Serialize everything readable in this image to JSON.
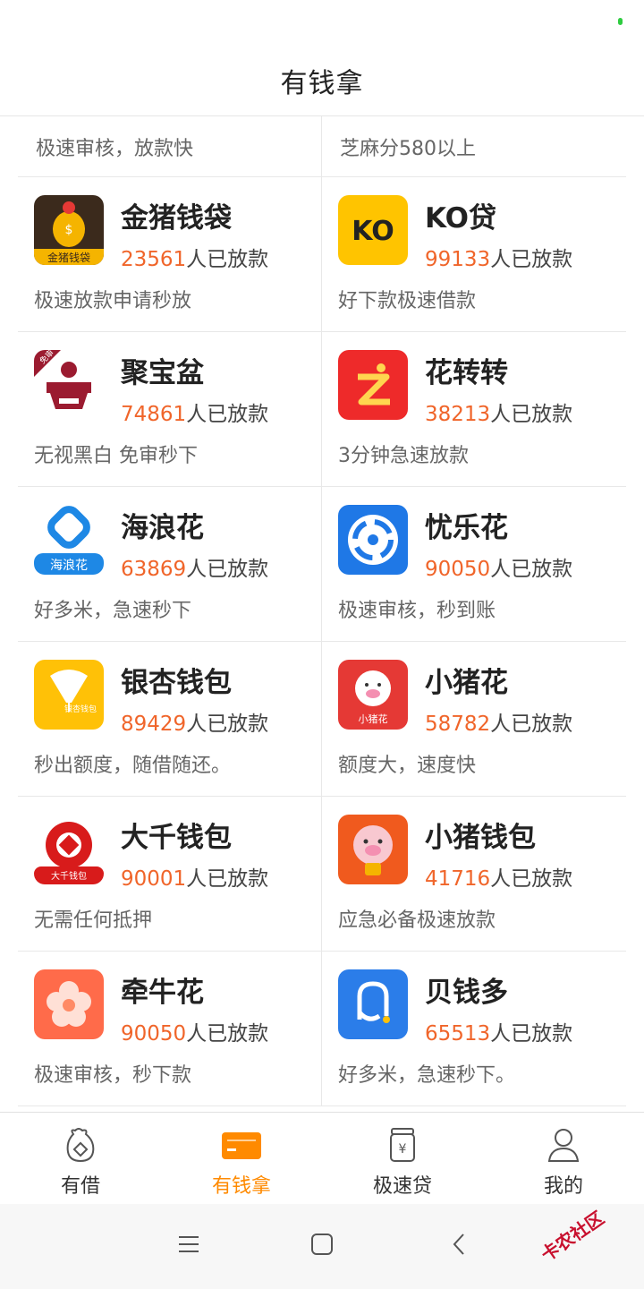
{
  "title": "有钱拿",
  "partial_row": {
    "left_desc": "极速审核，放款快",
    "right_desc": "芝麻分580以上"
  },
  "count_suffix": "人已放款",
  "apps": [
    {
      "name": "金猪钱袋",
      "count": "23561",
      "desc": "极速放款申请秒放",
      "icon": "golden-pig-bag-icon",
      "icon_text": "金猪钱袋",
      "color": "#3b2a1c"
    },
    {
      "name": "KO贷",
      "count": "99133",
      "desc": "好下款极速借款",
      "icon": "ko-loan-icon",
      "icon_text": "KO",
      "color": "#ffc400"
    },
    {
      "name": "聚宝盆",
      "count": "74861",
      "desc": "无视黑白 免审秒下",
      "icon": "treasure-bowl-icon",
      "icon_text": "免审",
      "color": "#9b1b30"
    },
    {
      "name": "花转转",
      "count": "38213",
      "desc": "3分钟急速放款",
      "icon": "hua-zhuanzhuan-icon",
      "icon_text": "",
      "color": "#ee2a2a"
    },
    {
      "name": "海浪花",
      "count": "63869",
      "desc": "好多米，急速秒下",
      "icon": "hailang-flower-icon",
      "icon_text": "海浪花",
      "color": "#1e88e5"
    },
    {
      "name": "忧乐花",
      "count": "90050",
      "desc": "极速审核，秒到账",
      "icon": "youle-flower-icon",
      "icon_text": "",
      "color": "#1f78e6"
    },
    {
      "name": "银杏钱包",
      "count": "89429",
      "desc": "秒出额度，随借随还。",
      "icon": "ginkgo-wallet-icon",
      "icon_text": "银杏钱包",
      "color": "#ffc107"
    },
    {
      "name": "小猪花",
      "count": "58782",
      "desc": "额度大，速度快",
      "icon": "little-pig-flower-icon",
      "icon_text": "小猪花",
      "color": "#e53935"
    },
    {
      "name": "大千钱包",
      "count": "90001",
      "desc": "无需任何抵押",
      "icon": "daqian-wallet-icon",
      "icon_text": "大千钱包",
      "color": "#d81b1b"
    },
    {
      "name": "小猪钱包",
      "count": "41716",
      "desc": "应急必备极速放款",
      "icon": "pig-wallet-icon",
      "icon_text": "",
      "color": "#f05a1e"
    },
    {
      "name": "牵牛花",
      "count": "90050",
      "desc": "极速审核，秒下款",
      "icon": "morning-glory-icon",
      "icon_text": "",
      "color": "#ff6b4a"
    },
    {
      "name": "贝钱多",
      "count": "65513",
      "desc": "好多米，急速秒下。",
      "icon": "bei-qianduo-icon",
      "icon_text": "",
      "color": "#2b7de9"
    }
  ],
  "tabs": [
    {
      "label": "有借",
      "icon": "loan-bag-icon",
      "active": false
    },
    {
      "label": "有钱拿",
      "icon": "card-icon",
      "active": true
    },
    {
      "label": "极速贷",
      "icon": "yen-jar-icon",
      "active": false
    },
    {
      "label": "我的",
      "icon": "person-icon",
      "active": false
    }
  ],
  "colors": {
    "accent": "#ff8a00",
    "count": "#f0652a"
  },
  "watermark": "卡农社区"
}
